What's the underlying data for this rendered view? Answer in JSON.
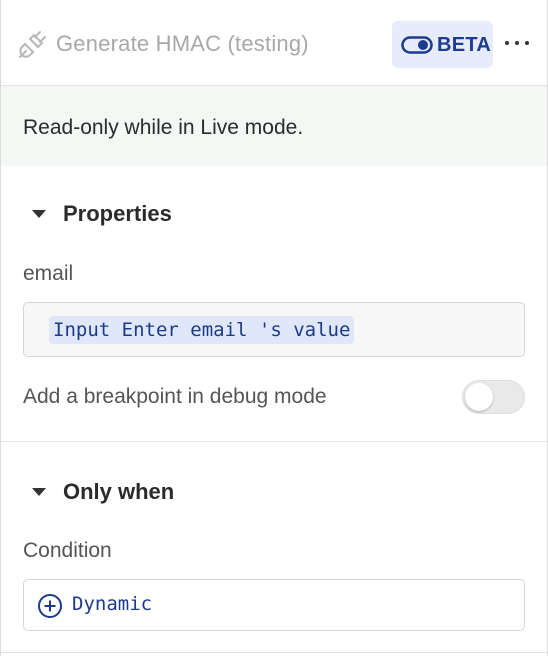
{
  "header": {
    "title": "Generate HMAC (testing)",
    "badge_label": "BETA",
    "plug_icon": "plug-icon",
    "toggle_icon": "toggle-icon",
    "more_icon": "more-horizontal-icon"
  },
  "banner": {
    "text": "Read-only while in Live mode."
  },
  "properties": {
    "heading": "Properties",
    "email_label": "email",
    "email_value": "Input Enter email 's value",
    "breakpoint_label": "Add a breakpoint in debug mode",
    "breakpoint_on": false
  },
  "only_when": {
    "heading": "Only when",
    "condition_label": "Condition",
    "condition_value": "Dynamic"
  },
  "colors": {
    "accent": "#1d3b8f",
    "badge_bg": "#e6ecfb",
    "banner_bg": "#f3f8f4",
    "token_bg": "#dfe7f8"
  }
}
